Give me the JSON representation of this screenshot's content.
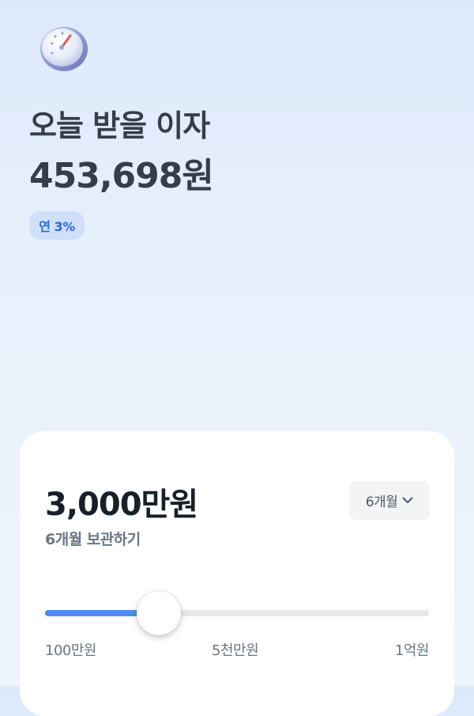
{
  "header": {
    "title": "오늘 받을 이자",
    "interest_amount": "453,698원",
    "rate_badge": "연 3%"
  },
  "deposit": {
    "amount": "3,000만원",
    "subtitle": "6개월 보관하기",
    "period_select": "6개월",
    "slider": {
      "min_label": "100만원",
      "mid_label": "5천만원",
      "max_label": "1억원",
      "min_value": 1000000,
      "max_value": 100000000,
      "value": 30000000
    }
  },
  "colors": {
    "accent": "#4a8ef5",
    "badge_bg": "#d0e0fa",
    "badge_text": "#2a6ad8",
    "title_text": "#333d4b"
  },
  "icons": {
    "header_icon": "gauge-icon",
    "select_chevron": "chevron-down-icon"
  }
}
